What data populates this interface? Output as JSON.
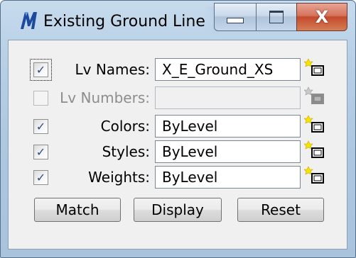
{
  "window": {
    "title": "Existing Ground Line",
    "close_glyph": "X"
  },
  "colors": {
    "accent": "#2f4c87",
    "title_bar": "#bcd2e8",
    "close_button": "#c44a2c"
  },
  "rows": [
    {
      "label": "Lv Names:",
      "value": "X_E_Ground_XS",
      "checked": true,
      "enabled": true
    },
    {
      "label": "Lv Numbers:",
      "value": "",
      "checked": false,
      "enabled": false
    },
    {
      "label": "Colors:",
      "value": "ByLevel",
      "checked": true,
      "enabled": true
    },
    {
      "label": "Styles:",
      "value": "ByLevel",
      "checked": true,
      "enabled": true
    },
    {
      "label": "Weights:",
      "value": "ByLevel",
      "checked": true,
      "enabled": true
    }
  ],
  "check_glyph": "✓",
  "buttons": {
    "match": "Match",
    "display": "Display",
    "reset": "Reset"
  },
  "icons": {
    "app": "microstation-m-icon",
    "picker": "pick-element-icon"
  }
}
